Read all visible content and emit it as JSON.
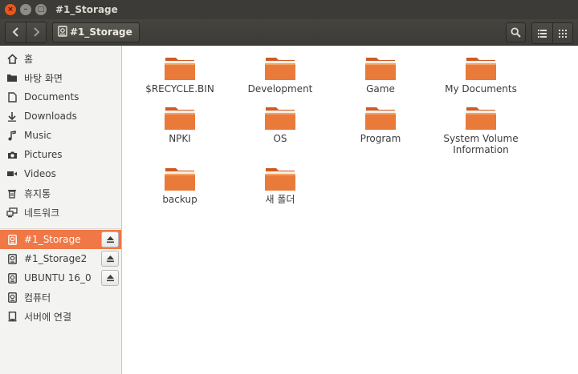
{
  "window": {
    "title": "#1_Storage",
    "close_glyph": "×",
    "min_glyph": "–",
    "max_glyph": "□"
  },
  "toolbar": {
    "back_glyph": "‹",
    "forward_glyph": "›",
    "path_label": "#1_Storage"
  },
  "sidebar": {
    "places": [
      {
        "label": "홈",
        "icon": "home-icon"
      },
      {
        "label": "바탕 화면",
        "icon": "desktop-folder-icon"
      },
      {
        "label": "Documents",
        "icon": "document-icon"
      },
      {
        "label": "Downloads",
        "icon": "download-icon"
      },
      {
        "label": "Music",
        "icon": "music-icon"
      },
      {
        "label": "Pictures",
        "icon": "camera-icon"
      },
      {
        "label": "Videos",
        "icon": "video-icon"
      },
      {
        "label": "휴지통",
        "icon": "trash-icon"
      },
      {
        "label": "네트워크",
        "icon": "network-icon"
      }
    ],
    "devices": [
      {
        "label": "#1_Storage",
        "icon": "drive-icon",
        "active": true,
        "ejectable": true
      },
      {
        "label": "#1_Storage2",
        "icon": "drive-icon",
        "active": false,
        "ejectable": true
      },
      {
        "label": "UBUNTU 16_0",
        "icon": "drive-icon",
        "active": false,
        "ejectable": true
      },
      {
        "label": "컴퓨터",
        "icon": "drive-icon",
        "active": false,
        "ejectable": false
      },
      {
        "label": "서버에 연결",
        "icon": "server-icon",
        "active": false,
        "ejectable": false
      }
    ]
  },
  "files": [
    {
      "name": "$RECYCLE.BIN"
    },
    {
      "name": "Development"
    },
    {
      "name": "Game"
    },
    {
      "name": "My Documents"
    },
    {
      "name": "NPKI"
    },
    {
      "name": "OS"
    },
    {
      "name": "Program"
    },
    {
      "name": "System Volume\nInformation"
    },
    {
      "name": "backup"
    },
    {
      "name": "새 폴더"
    }
  ],
  "colors": {
    "accent": "#f07746",
    "folder_light": "#f6a15f",
    "folder_dark": "#e0642a",
    "titlebar": "#3c3b37"
  }
}
